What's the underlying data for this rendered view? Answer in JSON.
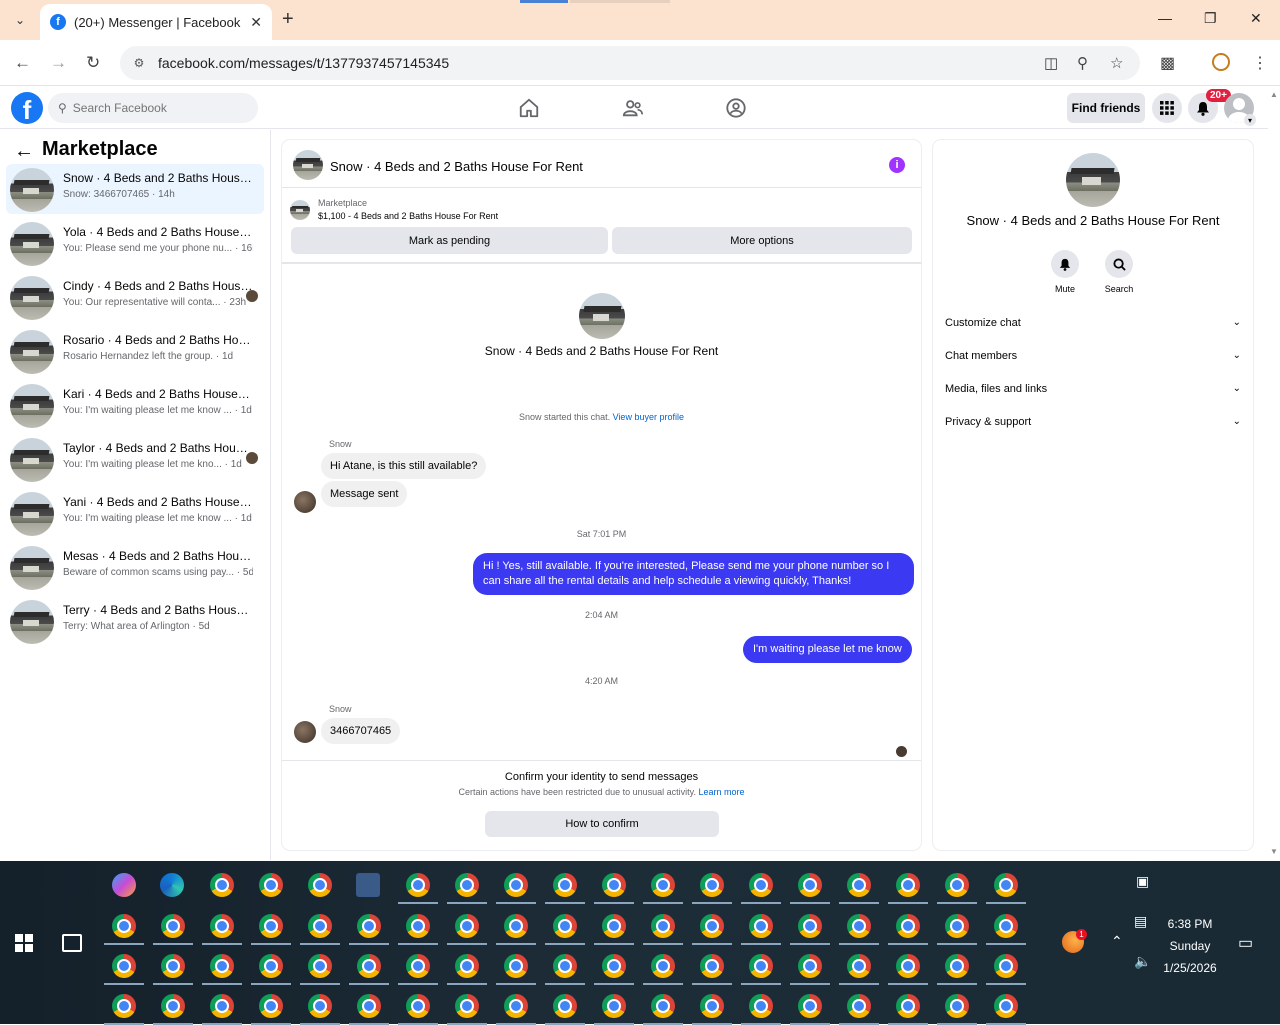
{
  "browser": {
    "tab_title": "(20+) Messenger | Facebook",
    "url": "facebook.com/messages/t/1377937457145345"
  },
  "fb_header": {
    "search_placeholder": "Search Facebook",
    "find_friends": "Find friends",
    "notification_count": "20+"
  },
  "left_panel": {
    "title": "Marketplace",
    "chats": [
      {
        "name": "Snow · 4 Beds and 2 Baths House For Rent",
        "preview": "Snow: 3466707465 · 14h",
        "active": true,
        "seen": false
      },
      {
        "name": "Yola · 4 Beds and 2 Baths House For Rent",
        "preview": "You: Please send me your phone nu... · 16h",
        "active": false,
        "seen": false
      },
      {
        "name": "Cindy · 4 Beds and 2 Baths House For Rent",
        "preview": "You: Our representative will conta... · 23h",
        "active": false,
        "seen": true
      },
      {
        "name": "Rosario · 4 Beds and 2 Baths House For Rent",
        "preview": "Rosario Hernandez left the group. · 1d",
        "active": false,
        "seen": false
      },
      {
        "name": "Kari · 4 Beds and 2 Baths House For Rent",
        "preview": "You: I'm waiting please let me know ... · 1d",
        "active": false,
        "seen": false
      },
      {
        "name": "Taylor · 4 Beds and 2 Baths House For Rent",
        "preview": "You: I'm waiting please let me kno... · 1d",
        "active": false,
        "seen": true
      },
      {
        "name": "Yani · 4 Beds and 2 Baths House For Rent",
        "preview": "You: I'm waiting please let me know ... · 1d",
        "active": false,
        "seen": false
      },
      {
        "name": "Mesas · 4 Beds and 2 Baths House For Rent",
        "preview": "Beware of common scams using pay... · 5d",
        "active": false,
        "seen": false
      },
      {
        "name": "Terry · 4 Beds and 2 Baths House For Rent",
        "preview": "Terry: What area of Arlington · 5d",
        "active": false,
        "seen": false
      }
    ]
  },
  "conversation": {
    "header_title": "Snow · 4 Beds and 2 Baths House For Rent",
    "marketplace_label": "Marketplace",
    "listing_title": "$1,100 - 4 Beds and 2 Baths House For Rent",
    "mark_pending": "Mark as pending",
    "more_options": "More options",
    "center_title": "Snow · 4 Beds and 2 Baths House For Rent",
    "started_note": "Snow started this chat.",
    "view_buyer_profile": "View buyer profile",
    "sender_name": "Snow",
    "msg_in_1": "Hi Atane, is this still available?",
    "msg_in_2": "Message sent",
    "time_1": "Sat 7:01 PM",
    "msg_out_1": "Hi ! Yes, still available. If you're interested, Please send me your phone number so I can share all the rental details and help schedule a viewing quickly, Thanks!",
    "time_2": "2:04 AM",
    "msg_out_2": "I'm waiting please let me know",
    "time_3": "4:20 AM",
    "sender_name_2": "Snow",
    "msg_in_3": "3466707465",
    "confirm_title": "Confirm your identity to send messages",
    "confirm_sub": "Certain actions have been restricted due to unusual activity.",
    "learn_more": "Learn more",
    "how_to_confirm": "How to confirm"
  },
  "right_panel": {
    "title": "Snow · 4 Beds and 2 Baths House For Rent",
    "mute": "Mute",
    "search": "Search",
    "sections": [
      "Customize chat",
      "Chat members",
      "Media, files and links",
      "Privacy & support"
    ]
  },
  "taskbar": {
    "time": "6:38 PM",
    "day": "Sunday",
    "date": "1/25/2026",
    "badge_count": "1"
  },
  "colors": {
    "fb_blue": "#1877f2",
    "outgoing_bubble": "#3b39f1",
    "tab_bar": "#fbe3cf",
    "info_icon": "#a033ff"
  }
}
